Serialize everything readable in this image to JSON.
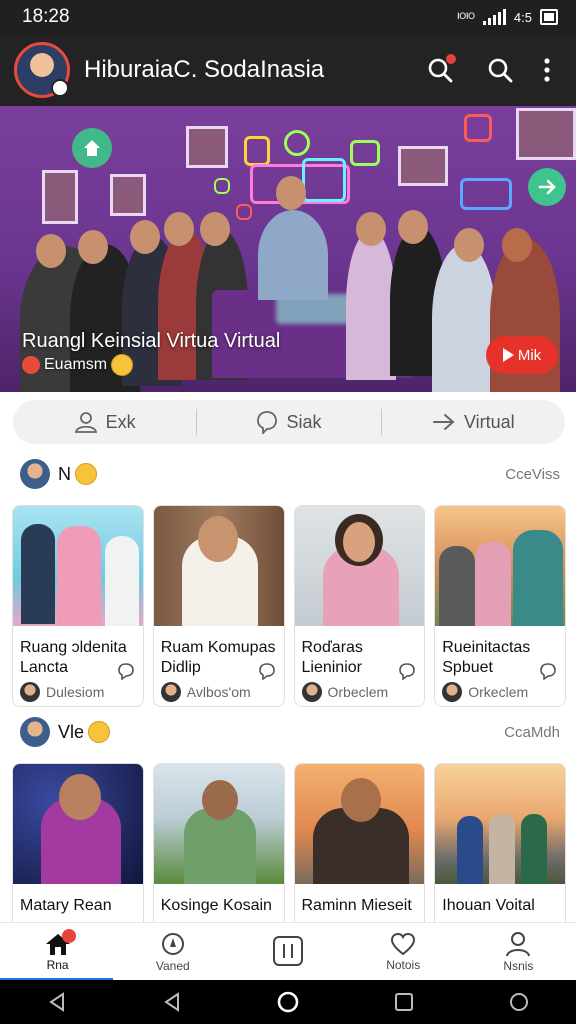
{
  "status_bar": {
    "time": "18:28",
    "carrier": "ᴵᴼᴵᴼ",
    "battery_text": "4:5"
  },
  "app_bar": {
    "title": "HiburaiaC. SodaInasia"
  },
  "hero": {
    "caption": "Ruangl Keinsial Virtua Virtual",
    "sub": "Euamsm",
    "play_label": "Mik"
  },
  "segments": [
    {
      "label": "Exk",
      "icon": "user-icon"
    },
    {
      "label": "Siak",
      "icon": "bubble-icon"
    },
    {
      "label": "Virtual",
      "icon": "arrow-right-icon"
    }
  ],
  "sections": [
    {
      "title": "N",
      "more": "CceViss",
      "cards": [
        {
          "title": "Ruang ɔldenita Lancta",
          "author": "Dulesiom"
        },
        {
          "title": "Ruam Komupas Didlip",
          "author": "Avlbos'om"
        },
        {
          "title": "Roďaras Lieninior",
          "author": "Orbeclem"
        },
        {
          "title": "Rueinitactas Spbuet",
          "author": "Orkeclem"
        }
      ]
    },
    {
      "title": "Vle",
      "more": "CcaMdh",
      "cards": [
        {
          "title": "Matary Rean",
          "author": ""
        },
        {
          "title": "Kosinge Kosain",
          "author": ""
        },
        {
          "title": "Raminn Mieseit",
          "author": ""
        },
        {
          "title": "Ihouan Voital",
          "author": ""
        }
      ]
    }
  ],
  "bottom_nav": [
    {
      "label": "Rna",
      "icon": "home-icon",
      "active": true
    },
    {
      "label": "Vaned",
      "icon": "compass-icon"
    },
    {
      "label": "",
      "icon": "square-bars-icon"
    },
    {
      "label": "Notois",
      "icon": "heart-icon"
    },
    {
      "label": "Nsnis",
      "icon": "profile-icon"
    }
  ],
  "colors": {
    "accent": "#1a73e8",
    "brand_red": "#e5322b",
    "hero_purple": "#7a3f9b"
  }
}
